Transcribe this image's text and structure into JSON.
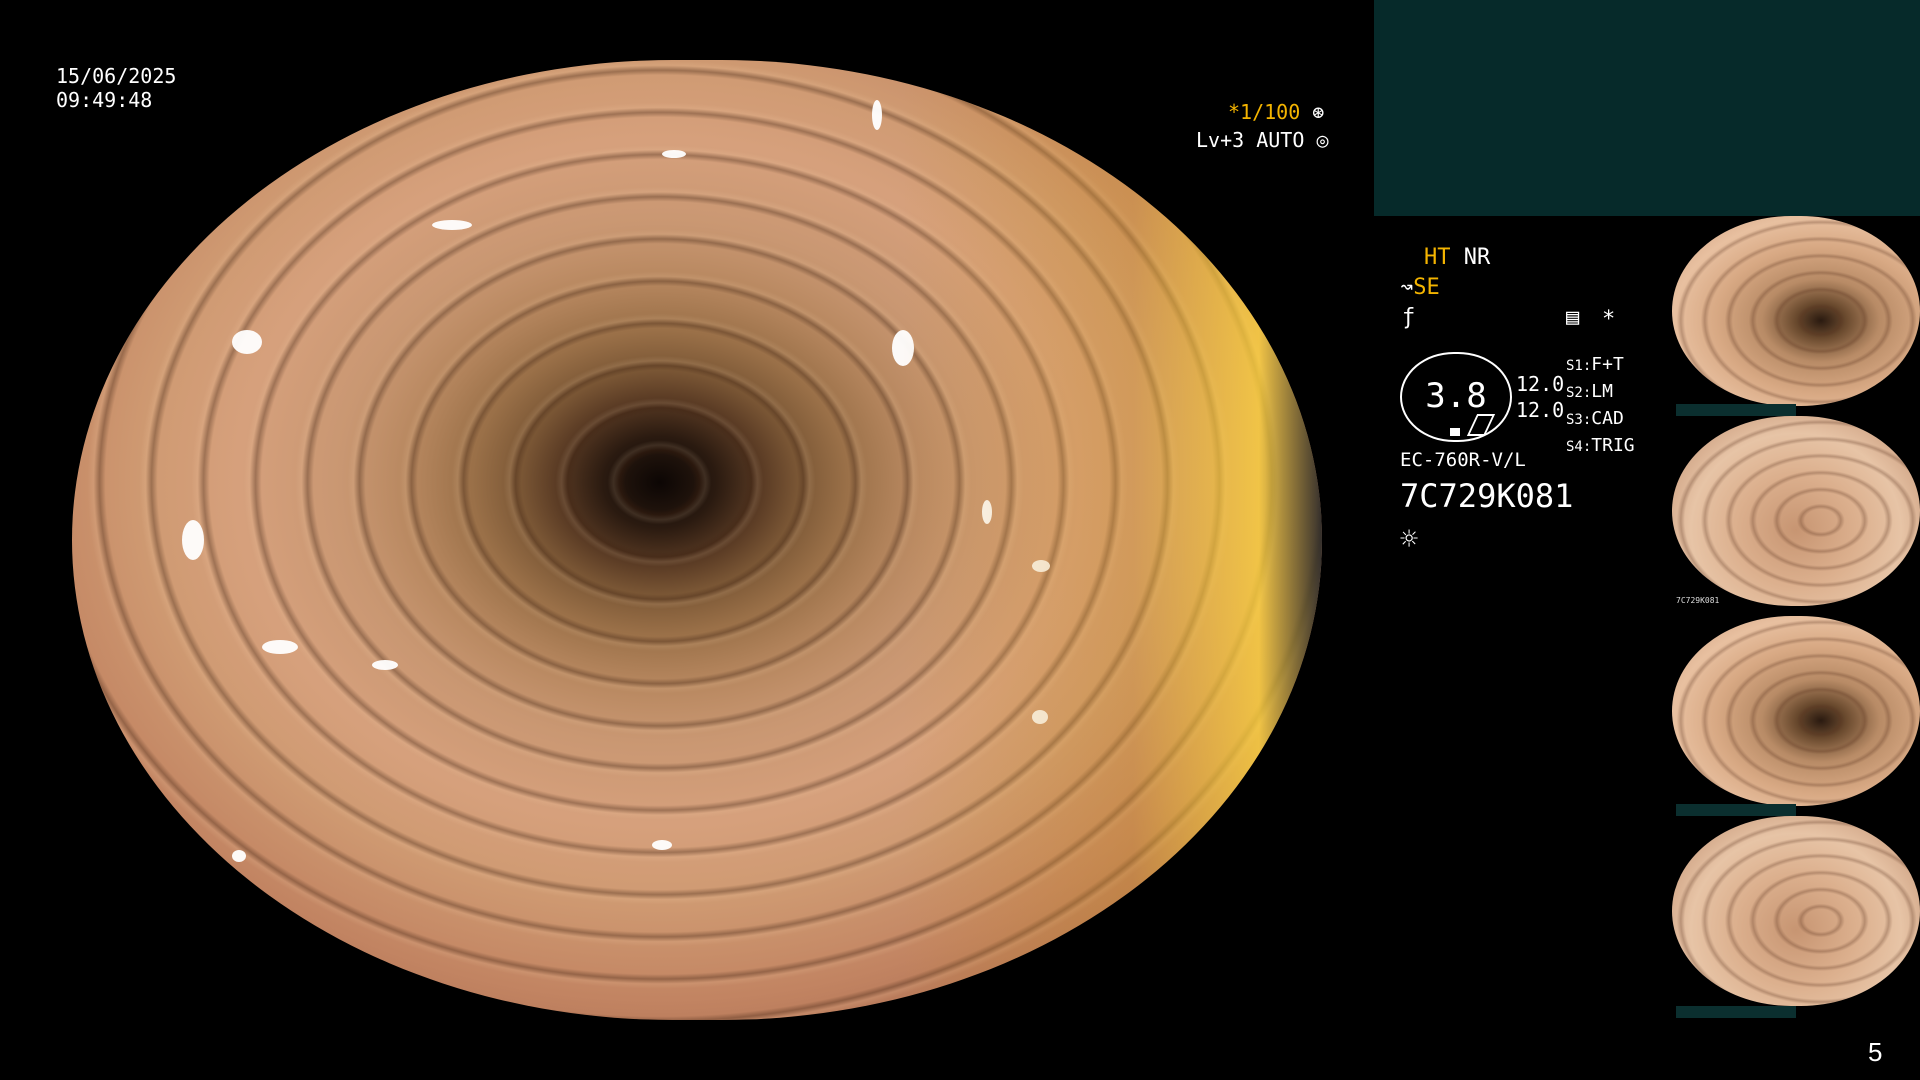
{
  "overlay": {
    "date": "15/06/2025",
    "time": "09:49:48",
    "shutter": "*1/100",
    "light_level": "Lv+3",
    "light_mode": "AUTO"
  },
  "sidebar": {
    "ht": "HT",
    "nr": "NR",
    "se": "SE",
    "zoom_value": "3.8",
    "values": [
      "12.0",
      "12.0"
    ],
    "switches": [
      {
        "key": "S1:",
        "value": "F+T"
      },
      {
        "key": "S2:",
        "value": "LM"
      },
      {
        "key": "S3:",
        "value": "CAD"
      },
      {
        "key": "S4:",
        "value": "TRIG"
      }
    ],
    "scope_model": "EC-760R-V/L",
    "scope_serial": "7C729K081",
    "asterisk": "*"
  },
  "thumbnail_label": "7C729K081",
  "page_number": "5",
  "colors": {
    "accent_yellow": "#f4b400",
    "panel_teal": "#062a2a",
    "thumb_tag": "#0b2f2f"
  }
}
